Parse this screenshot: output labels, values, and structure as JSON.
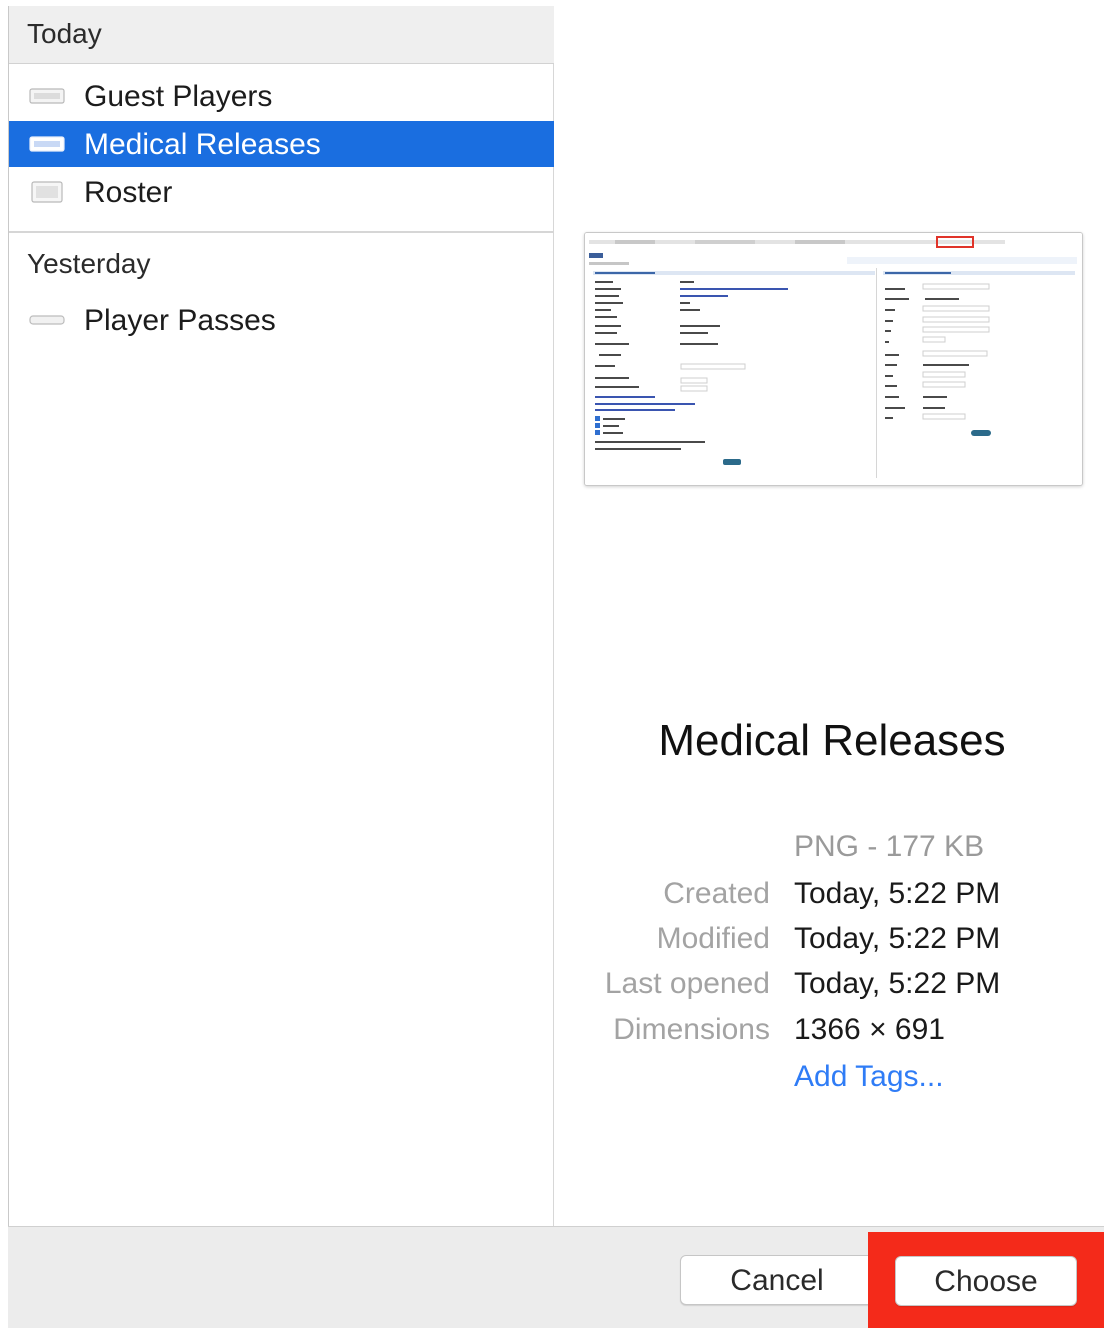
{
  "sidebar": {
    "today_header": "Today",
    "today_items": [
      {
        "label": "Guest Players",
        "icon": "image-file-icon"
      },
      {
        "label": "Medical Releases",
        "icon": "image-file-icon",
        "selected": true
      },
      {
        "label": "Roster",
        "icon": "image-file-icon"
      }
    ],
    "yesterday_header": "Yesterday",
    "yesterday_items": [
      {
        "label": "Player Passes",
        "icon": "image-file-icon"
      }
    ]
  },
  "preview": {
    "title": "Medical Releases",
    "file_type": "PNG - 177 KB",
    "created_label": "Created",
    "created_value": "Today, 5:22 PM",
    "modified_label": "Modified",
    "modified_value": "Today, 5:22 PM",
    "last_opened_label": "Last opened",
    "last_opened_value": "Today, 5:22 PM",
    "dimensions_label": "Dimensions",
    "dimensions_value": "1366 × 691",
    "add_tags": "Add Tags..."
  },
  "footer": {
    "cancel_label": "Cancel",
    "choose_label": "Choose"
  },
  "colors": {
    "selection": "#1a6ee0",
    "link": "#2f7cf6",
    "highlight": "#f42a1a"
  }
}
